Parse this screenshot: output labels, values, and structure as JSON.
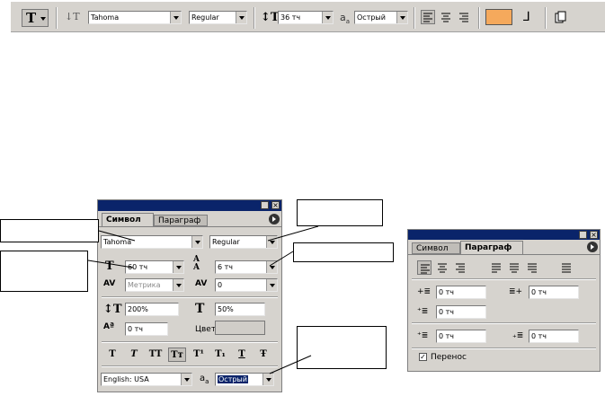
{
  "toolbar": {
    "font_family": "Tahoma",
    "font_style": "Regular",
    "font_size": "36 тч",
    "antialias": "Острый",
    "color_swatch": "#f5a95c"
  },
  "char_panel": {
    "tabs": [
      "Символ",
      "Параграф"
    ],
    "font_family": "Tahoma",
    "font_style": "Regular",
    "font_size": "60 тч",
    "leading": "6 тч",
    "kerning": "Метрика",
    "tracking": "0",
    "vert_scale": "200%",
    "horiz_scale": "50%",
    "baseline": "0 тч",
    "color_label": "Цвет:",
    "language": "English: USA",
    "antialias": "Острый",
    "style_buttons": [
      "T",
      "T",
      "TT",
      "Tт",
      "T¹",
      "T₁",
      "T",
      "Ŧ"
    ]
  },
  "para_panel": {
    "tabs": [
      "Символ",
      "Параграф"
    ],
    "indent_left": "0 тч",
    "indent_right": "0 тч",
    "indent_first": "0 тч",
    "space_before": "0 тч",
    "space_after": "0 тч",
    "hyphenate_label": "Перенос"
  }
}
